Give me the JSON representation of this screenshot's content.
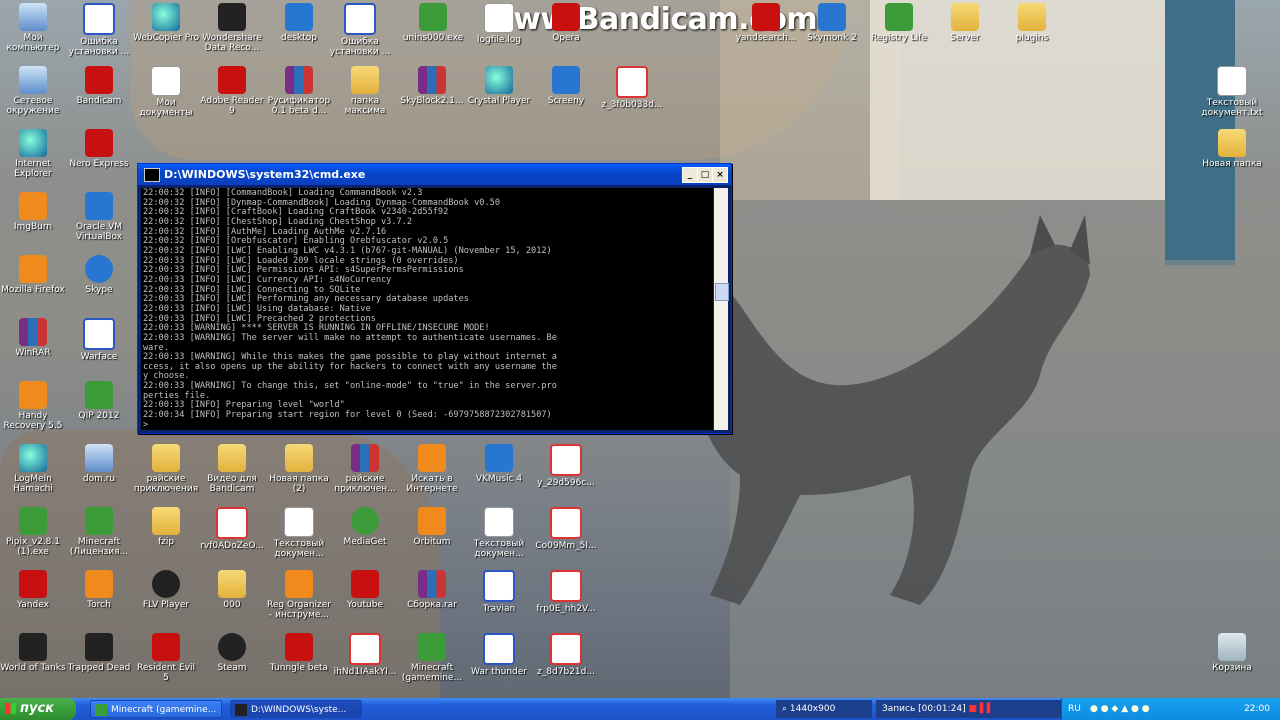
{
  "watermark": "www.Bandicam.com",
  "desktop_icons": [
    {
      "label": "Мой компьютер",
      "icon": "computer-icon"
    },
    {
      "label": "Ошибка установки ...",
      "icon": "window-icon"
    },
    {
      "label": "WebCopier Pro",
      "icon": "globe-icon"
    },
    {
      "label": "Wondershare Data Reco...",
      "icon": "recovery-icon"
    },
    {
      "label": "desktop",
      "icon": "monitor-icon"
    },
    {
      "label": "Ошибка установки ...",
      "icon": "window-icon"
    },
    {
      "label": "unins000.exe",
      "icon": "installer-icon"
    },
    {
      "label": "Сетевое окружение",
      "icon": "network-icon"
    },
    {
      "label": "Bandicam",
      "icon": "record-icon"
    },
    {
      "label": "Мои документы",
      "icon": "documents-icon"
    },
    {
      "label": "Adobe Reader 9",
      "icon": "pdf-icon"
    },
    {
      "label": "Русификатор 0.1 beta d...",
      "icon": "archive-icon"
    },
    {
      "label": "папка максима",
      "icon": "folder-icon"
    },
    {
      "label": "SkyBlock2.1...",
      "icon": "archive-icon"
    },
    {
      "label": "Crystal Player",
      "icon": "player-icon"
    },
    {
      "label": "Screeny",
      "icon": "screenshot-icon"
    },
    {
      "label": "z_3f0b033d...",
      "icon": "image-icon"
    },
    {
      "label": "Internet Explorer",
      "icon": "ie-icon"
    },
    {
      "label": "Nero Express",
      "icon": "nero-icon"
    },
    {
      "label": "ImgBurn",
      "icon": "disc-icon"
    },
    {
      "label": "Oracle VM VirtualBox",
      "icon": "virtualbox-icon"
    },
    {
      "label": "Mozilla Firefox",
      "icon": "firefox-icon"
    },
    {
      "label": "Skype",
      "icon": "skype-icon"
    },
    {
      "label": "WinRAR",
      "icon": "archive-icon"
    },
    {
      "label": "Warface",
      "icon": "game-icon"
    },
    {
      "label": "Handy Recovery 5.5",
      "icon": "recovery-icon"
    },
    {
      "label": "QIP 2012",
      "icon": "chat-icon"
    },
    {
      "label": "LogMeIn Hamachi",
      "icon": "hamachi-icon"
    },
    {
      "label": "dom.ru",
      "icon": "network-icon"
    },
    {
      "label": "райские приключения",
      "icon": "folder-icon"
    },
    {
      "label": "Видео для Bandicam",
      "icon": "folder-icon"
    },
    {
      "label": "Новая папка (2)",
      "icon": "folder-icon"
    },
    {
      "label": "райские приключен...",
      "icon": "archive-icon"
    },
    {
      "label": "Искать в Интернете",
      "icon": "search-web-icon"
    },
    {
      "label": "VKMusic 4",
      "icon": "music-icon"
    },
    {
      "label": "y_29d596c...",
      "icon": "image-icon"
    },
    {
      "label": "Pipix_v2.8.1 (1).exe",
      "icon": "app-icon"
    },
    {
      "label": "Minecraft (Лицензия...",
      "icon": "minecraft-icon"
    },
    {
      "label": "fzip",
      "icon": "zip-icon"
    },
    {
      "label": "rvf0ADoZeO...",
      "icon": "image-icon"
    },
    {
      "label": "Текстовый докумен...",
      "icon": "text-file-icon"
    },
    {
      "label": "MediaGet",
      "icon": "mediaget-icon"
    },
    {
      "label": "Orbitum",
      "icon": "browser-icon"
    },
    {
      "label": "Текстовый докумен...",
      "icon": "text-file-icon"
    },
    {
      "label": "Co09Mm_5I...",
      "icon": "image-icon"
    },
    {
      "label": "Yandex",
      "icon": "yandex-icon"
    },
    {
      "label": "Torch",
      "icon": "torch-icon"
    },
    {
      "label": "FLV Player",
      "icon": "player-icon"
    },
    {
      "label": "000",
      "icon": "folder-icon"
    },
    {
      "label": "Reg Organizer - инструме...",
      "icon": "registry-icon"
    },
    {
      "label": "Youtube",
      "icon": "youtube-icon"
    },
    {
      "label": "Сборка.rar",
      "icon": "archive-icon"
    },
    {
      "label": "Travian",
      "icon": "web-icon"
    },
    {
      "label": "frp0E_hh2V...",
      "icon": "image-icon"
    },
    {
      "label": "World of Tanks",
      "icon": "tank-icon"
    },
    {
      "label": "Trapped Dead",
      "icon": "game-icon"
    },
    {
      "label": "Resident Evil 5",
      "icon": "game-icon"
    },
    {
      "label": "Steam",
      "icon": "steam-icon"
    },
    {
      "label": "Tunngle beta",
      "icon": "tunngle-icon"
    },
    {
      "label": "ihNd1IAakYI...",
      "icon": "image-icon"
    },
    {
      "label": "Minecraft (gamemine...",
      "icon": "minecraft-icon"
    },
    {
      "label": "War thunder",
      "icon": "web-icon"
    },
    {
      "label": "z_8d7b21d...",
      "icon": "image-icon"
    },
    {
      "label": "Skymonk 2",
      "icon": "skymonk-icon"
    },
    {
      "label": "Registry Life",
      "icon": "registry-icon"
    },
    {
      "label": "Server",
      "icon": "folder-icon"
    },
    {
      "label": "plugins",
      "icon": "folder-icon"
    },
    {
      "label": "Текстовый документ.txt",
      "icon": "text-file-icon"
    },
    {
      "label": "Новая папка",
      "icon": "folder-icon"
    },
    {
      "label": "Корзина",
      "icon": "recycle-bin-icon"
    },
    {
      "label": "Opera",
      "icon": "browser-icon"
    },
    {
      "label": "yandsearch...",
      "icon": "web-icon"
    },
    {
      "label": "logfile.log",
      "icon": "text-file-icon"
    }
  ],
  "cmd": {
    "title": "D:\\WINDOWS\\system32\\cmd.exe",
    "minimize": "_",
    "maximize": "□",
    "close": "×",
    "lines": [
      "22:00:32 [INFO] [CommandBook] Loading CommandBook v2.3",
      "22:00:32 [INFO] [Dynmap-CommandBook] Loading Dynmap-CommandBook v0.50",
      "22:00:32 [INFO] [CraftBook] Loading CraftBook v2340-2d55f92",
      "22:00:32 [INFO] [ChestShop] Loading ChestShop v3.7.2",
      "22:00:32 [INFO] [AuthMe] Loading AuthMe v2.7.16",
      "22:00:32 [INFO] [Orebfuscator] Enabling Orebfuscator v2.0.5",
      "22:00:32 [INFO] [LWC] Enabling LWC v4.3.1 (b767-git-MANUAL) (November 15, 2012)",
      "22:00:33 [INFO] [LWC] Loaded 209 locale strings (0 overrides)",
      "22:00:33 [INFO] [LWC] Permissions API: s4SuperPermsPermissions",
      "22:00:33 [INFO] [LWC] Currency API: s4NoCurrency",
      "22:00:33 [INFO] [LWC] Connecting to SQLite",
      "22:00:33 [INFO] [LWC] Performing any necessary database updates",
      "22:00:33 [INFO] [LWC] Using database: Native",
      "22:00:33 [INFO] [LWC] Precached 2 protections",
      "22:00:33 [WARNING] **** SERVER IS RUNNING IN OFFLINE/INSECURE MODE!",
      "22:00:33 [WARNING] The server will make no attempt to authenticate usernames. Be",
      "ware.",
      "22:00:33 [WARNING] While this makes the game possible to play without internet a",
      "ccess, it also opens up the ability for hackers to connect with any username the",
      "y choose.",
      "22:00:33 [WARNING] To change this, set \"online-mode\" to \"true\" in the server.pro",
      "perties file.",
      "22:00:33 [INFO] Preparing level \"world\"",
      "22:00:34 [INFO] Preparing start region for level 0 (Seed: -6979758872302781507)",
      ">"
    ]
  },
  "taskbar": {
    "start": "пуск",
    "tasks": [
      {
        "label": "Minecraft (gamemine...",
        "active": false
      },
      {
        "label": "D:\\WINDOWS\\syste...",
        "active": true
      }
    ],
    "resolution": "1440x900",
    "record": "Запись [00:01:24]",
    "lang": "RU",
    "clock": "22:00"
  },
  "colors": {
    "taskbar": "#245edb",
    "start": "#3c9c3a",
    "tray": "#0f8be0",
    "titlebar": "#0a5cff"
  }
}
